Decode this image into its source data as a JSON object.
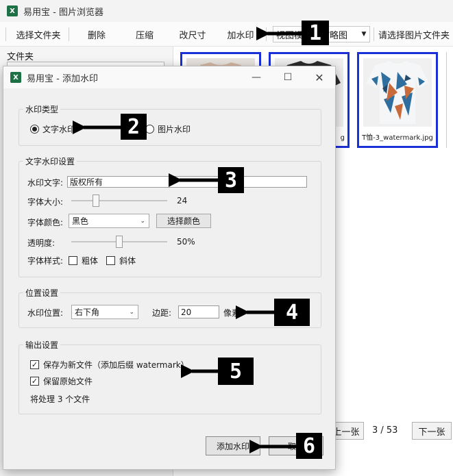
{
  "window": {
    "title": "易用宝 - 图片浏览器"
  },
  "toolbar": {
    "select_folder": "选择文件夹",
    "delete": "删除",
    "compress": "压缩",
    "resize": "改尺寸",
    "watermark": "加水印",
    "view_mode": "视图模式：缩略图",
    "choose_folder_hint": "请选择图片文件夹"
  },
  "left_panel": {
    "label": "文件夹"
  },
  "gallery": {
    "thumbnails": [
      {
        "caption": ""
      },
      {
        "caption": "g"
      },
      {
        "caption": "T恤-3_watermark.jpg"
      }
    ],
    "prev": "上一张",
    "page": "3 / 53",
    "next": "下一张"
  },
  "dialog": {
    "title": "易用宝 - 添加水印",
    "type_group": {
      "label": "水印类型",
      "text_option": "文字水印",
      "image_option": "图片水印",
      "selected": "text"
    },
    "text_group": {
      "label": "文字水印设置",
      "text_label": "水印文字:",
      "text_value": "版权所有",
      "size_label": "字体大小:",
      "size_value": "24",
      "size_level": 0.24,
      "color_label": "字体颜色:",
      "color_value": "黑色",
      "choose_color": "选择颜色",
      "opacity_label": "透明度:",
      "opacity_value": "50%",
      "opacity_level": 0.5,
      "style_label": "字体样式:",
      "bold": "粗体",
      "italic": "斜体"
    },
    "position_group": {
      "label": "位置设置",
      "pos_label": "水印位置:",
      "pos_value": "右下角",
      "margin_label": "边距:",
      "margin_value": "20",
      "unit": "像素"
    },
    "output_group": {
      "label": "输出设置",
      "save_new": "保存为新文件（添加后缀 watermark）",
      "keep_original": "保留原始文件",
      "count": "将处理 3 个文件"
    },
    "apply": "添加水印",
    "cancel": "取消"
  },
  "annotations": [
    "1",
    "2",
    "3",
    "4",
    "5",
    "6"
  ]
}
